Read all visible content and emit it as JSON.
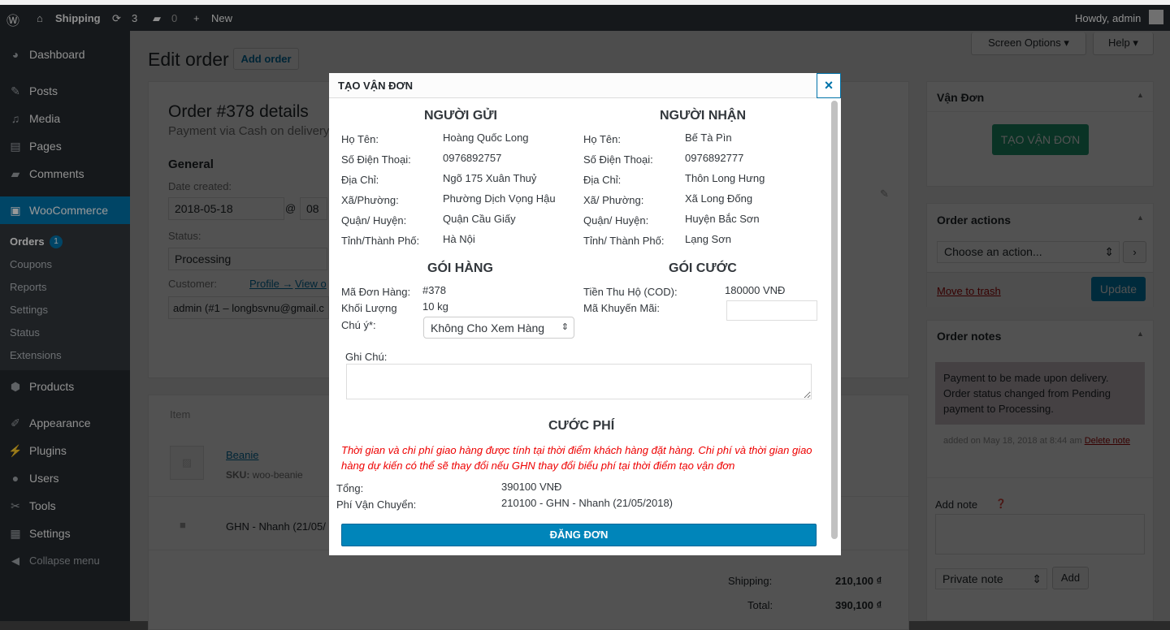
{
  "admin_bar": {
    "site": "Shipping",
    "updates": "3",
    "comments": "0",
    "new": "New",
    "howdy": "Howdy, admin"
  },
  "sidebar": {
    "items": [
      {
        "label": "Dashboard",
        "icon": "dashboard-icon"
      },
      {
        "label": "Posts",
        "icon": "pin-icon"
      },
      {
        "label": "Media",
        "icon": "media-icon"
      },
      {
        "label": "Pages",
        "icon": "pages-icon"
      },
      {
        "label": "Comments",
        "icon": "comment-icon"
      },
      {
        "label": "WooCommerce",
        "icon": "woo-icon"
      },
      {
        "label": "Products",
        "icon": "products-icon"
      },
      {
        "label": "Appearance",
        "icon": "brush-icon"
      },
      {
        "label": "Plugins",
        "icon": "plugin-icon"
      },
      {
        "label": "Users",
        "icon": "user-icon"
      },
      {
        "label": "Tools",
        "icon": "wrench-icon"
      },
      {
        "label": "Settings",
        "icon": "settings-icon"
      },
      {
        "label": "Collapse menu",
        "icon": "collapse-icon"
      }
    ],
    "sub": [
      "Orders",
      "Coupons",
      "Reports",
      "Settings",
      "Status",
      "Extensions"
    ],
    "orders_badge": "1"
  },
  "page": {
    "title": "Edit order",
    "add_order": "Add order",
    "screen_options": "Screen Options",
    "help": "Help",
    "order_title": "Order #378 details",
    "payment": "Payment via Cash on delivery",
    "general": "General",
    "date_created_label": "Date created:",
    "date": "2018-05-18",
    "at": "@",
    "hour": "08",
    "status_label": "Status:",
    "status": "Processing",
    "customer_label": "Customer:",
    "profile": "Profile →",
    "view": "View o",
    "customer": "admin (#1 – longbsvnu@gmail.c",
    "item_header": "Item",
    "item_name": "Beanie",
    "sku_label": "SKU:",
    "sku": "woo-beanie",
    "shipping_line": "GHN - Nhanh (21/05/",
    "shipping_label": "Shipping:",
    "shipping_total": "210,100 ₫",
    "total_label": "Total:",
    "total": "390,100 ₫"
  },
  "right": {
    "van_don_title": "Vận Đơn",
    "tao_van_don": "TẠO VẬN ĐƠN",
    "order_actions": "Order actions",
    "choose_action": "Choose an action...",
    "move_trash": "Move to trash",
    "update": "Update",
    "order_notes": "Order notes",
    "note": "Payment to be made upon delivery. Order status changed from Pending payment to Processing.",
    "note_meta": "added on May 18, 2018 at 8:44 am",
    "delete_note": "Delete note",
    "add_note": "Add note",
    "note_type": "Private note",
    "add": "Add"
  },
  "modal": {
    "title": "TẠO VẬN ĐƠN",
    "close": "×",
    "sender": {
      "heading": "NGƯỜI GỬI",
      "rows": [
        [
          "Họ Tên:",
          "Hoàng Quốc Long"
        ],
        [
          "Số Điện Thoại:",
          "0976892757"
        ],
        [
          "Địa Chỉ:",
          "Ngõ 175 Xuân Thuỷ"
        ],
        [
          "Xã/Phường:",
          "Phường Dịch Vọng Hậu"
        ],
        [
          "Quận/ Huyện:",
          "Quận Cầu Giấy"
        ],
        [
          "Tỉnh/Thành Phố:",
          "Hà Nội"
        ]
      ]
    },
    "receiver": {
      "heading": "NGƯỜI NHẬN",
      "rows": [
        [
          "Họ Tên:",
          "Bế Tà Pìn"
        ],
        [
          "Số Điện Thoại:",
          "0976892777"
        ],
        [
          "Địa Chỉ:",
          "Thôn Long Hưng"
        ],
        [
          "Xã/ Phường:",
          "Xã Long Đống"
        ],
        [
          "Quận/ Huyện:",
          "Huyện Bắc Sơn"
        ],
        [
          "Tỉnh/ Thành Phố:",
          "Lạng Sơn"
        ]
      ]
    },
    "package": {
      "heading": "GÓI HÀNG",
      "order_code_label": "Mã Đơn Hàng:",
      "order_code": "#378",
      "weight_label": "Khối Lượng",
      "weight": "10 kg",
      "note_label": "Chú ý*:",
      "note_option": "Không Cho Xem Hàng"
    },
    "fee_pkg": {
      "heading": "GÓI CƯỚC",
      "cod_label": "Tiền Thu Hộ (COD):",
      "cod": "180000 VNĐ",
      "promo_label": "Mã Khuyến Mãi:",
      "promo": ""
    },
    "remark_label": "Ghi Chú:",
    "fees": {
      "heading": "CƯỚC PHÍ",
      "warning": "Thời gian và chi phí giao hàng được tính tại thời điểm khách hàng đặt hàng. Chi phí và thời gian giao hàng dự kiến có thể sẽ thay đổi nếu GHN thay đổi biểu phí tại thời điểm tạo vận đơn",
      "total_label": "Tổng:",
      "total": "390100 VNĐ",
      "ship_label": "Phí Vận Chuyển:",
      "ship": "210100 - GHN - Nhanh (21/05/2018)"
    },
    "submit": "ĐĂNG ĐƠN"
  }
}
